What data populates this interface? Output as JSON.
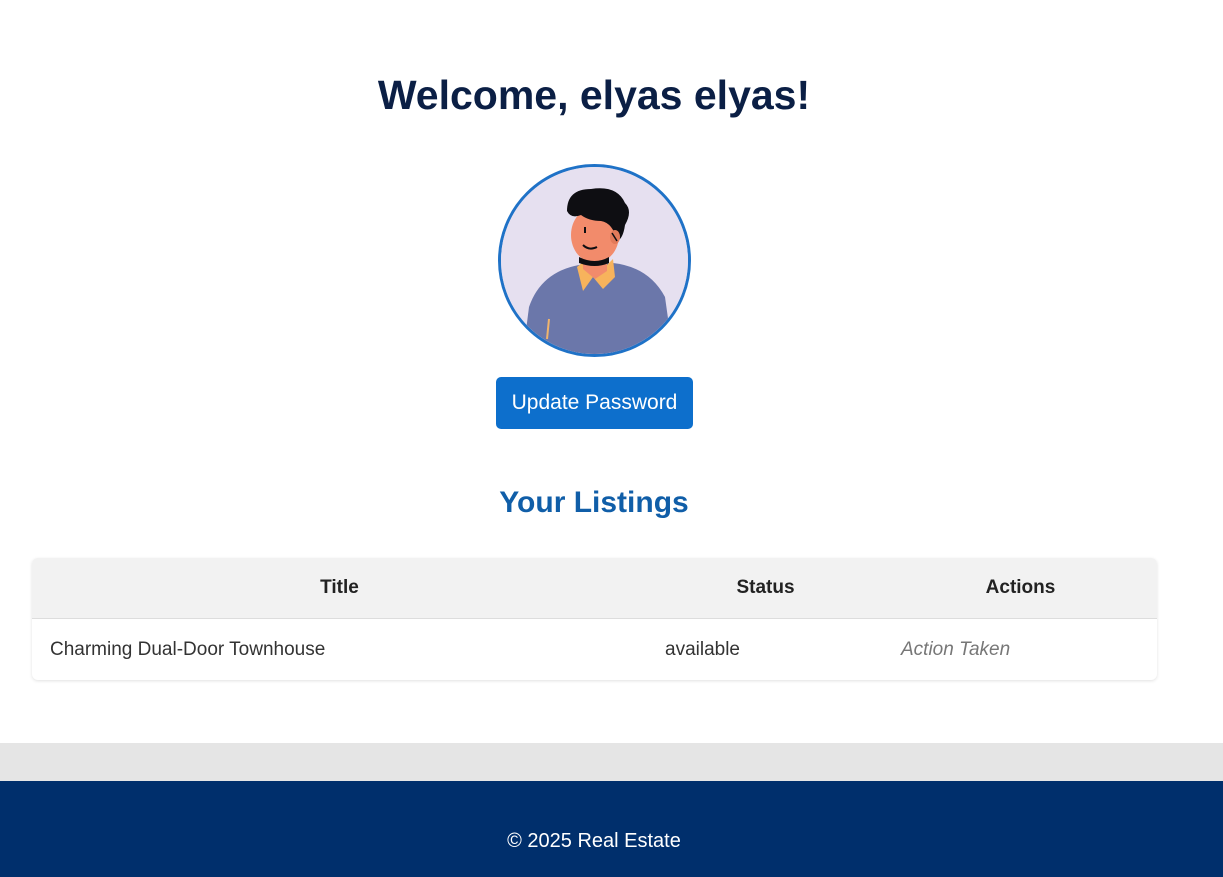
{
  "header": {
    "welcome_text": "Welcome, elyas elyas!"
  },
  "profile": {
    "avatar_icon": "user-avatar-illustration",
    "update_password_label": "Update Password"
  },
  "listings": {
    "title": "Your Listings",
    "columns": [
      "Title",
      "Status",
      "Actions"
    ],
    "rows": [
      {
        "title": "Charming Dual-Door Townhouse",
        "status": "available",
        "action": "Action Taken"
      }
    ]
  },
  "footer": {
    "copyright": "© 2025 Real Estate"
  },
  "colors": {
    "heading": "#0b1f45",
    "accent": "#0d6fcc",
    "listings_title": "#105ea8",
    "footer_bg": "#002f6c"
  }
}
